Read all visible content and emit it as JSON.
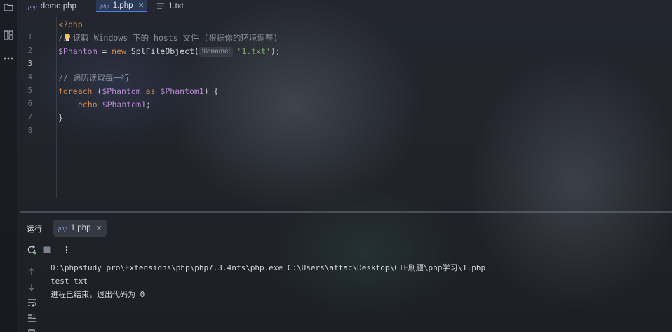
{
  "tabs": [
    {
      "label": "demo.php",
      "icon": "php-file-icon",
      "badge": "php",
      "active": false
    },
    {
      "label": "1.php",
      "icon": "php-file-icon",
      "badge": "php",
      "active": true
    },
    {
      "label": "1.txt",
      "icon": "text-file-icon",
      "active": false
    }
  ],
  "editor": {
    "line_numbers": [
      "1",
      "2",
      "3",
      "4",
      "5",
      "6",
      "7",
      "8"
    ],
    "current_line": "3",
    "line1": {
      "open_tag": "<?php"
    },
    "line2": {
      "comment_prefix": "//",
      "comment_text": " 读取 Windows 下的 hosts 文件 (根据你的环境调整)"
    },
    "line3": {
      "var": "$Phantom",
      "op": " = ",
      "kw_new": "new",
      "cls": " SplFileObject(",
      "hint": "filename:",
      "str": "'1.txt'",
      "end": ");"
    },
    "line5": {
      "comment": "// 遍历读取每一行"
    },
    "line6": {
      "kw_foreach": "foreach",
      "p1": " (",
      "var1": "$Phantom",
      "kw_as": " as ",
      "var2": "$Phantom1",
      "p2": ") {"
    },
    "line7": {
      "kw_echo": "echo",
      "sp": " ",
      "var": "$Phantom1",
      "end": ";"
    },
    "line8": {
      "brace": "}"
    }
  },
  "run_panel": {
    "title": "运行",
    "tab_label": "1.php",
    "tab_badge": "php",
    "console_lines": [
      "D:\\phpstudy_pro\\Extensions\\php\\php7.3.4nts\\php.exe C:\\Users\\attac\\Desktop\\CTF刷题\\php学习\\1.php",
      "test txt",
      "进程已结束，退出代码为 0"
    ]
  },
  "colors": {
    "keyword": "#d1894f",
    "variable": "#b78bd0",
    "string": "#7fb06a",
    "comment": "#8a909a",
    "accent": "#4e7fd6"
  }
}
